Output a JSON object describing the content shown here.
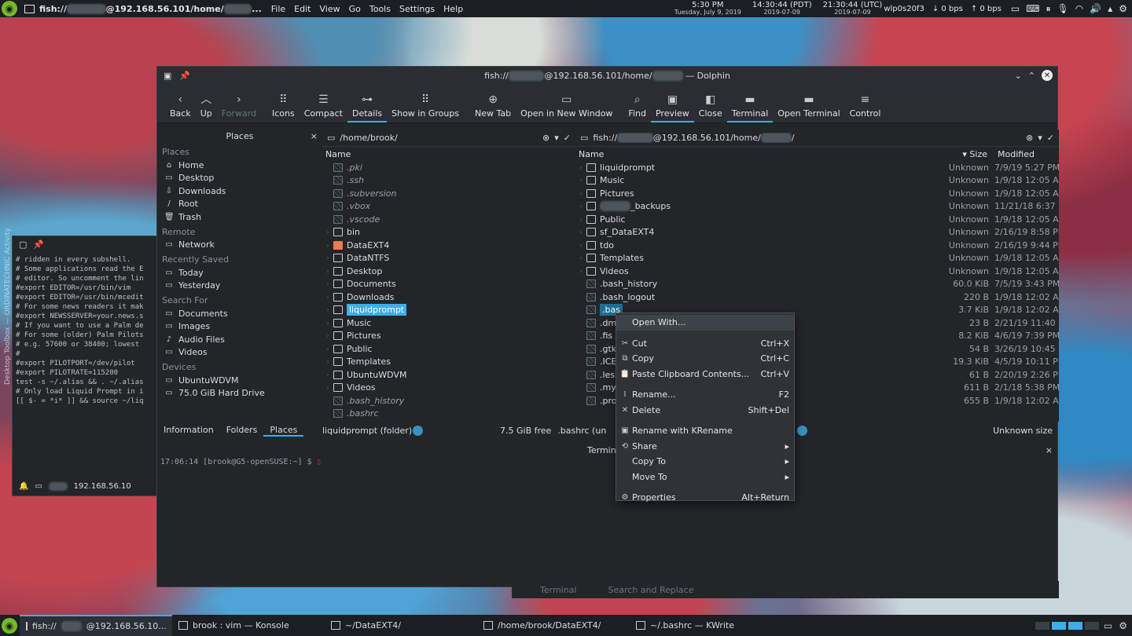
{
  "top_panel": {
    "window_title_prefix": "fish://",
    "window_title_suffix": "@192.168.56.101/home/",
    "window_title_end": "...",
    "menu": [
      "File",
      "Edit",
      "View",
      "Go",
      "Tools",
      "Settings",
      "Help"
    ],
    "clocks": [
      {
        "time": "5:30 PM",
        "date": "Tuesday, July 9, 2019"
      },
      {
        "time": "14:30:44 (PDT)",
        "date": "2019-07-09"
      },
      {
        "time": "21:30:44 (UTC)",
        "date": "2019-07-09"
      }
    ],
    "net_iface": "wlp0s20f3",
    "down_speed": "↓ 0 bps",
    "up_speed": "↑ 0 bps"
  },
  "vertical_label": "Desktop Toolbox — ORDINATECHNIC Activity",
  "vim": {
    "lines": [
      "# ridden in every subshell.",
      "",
      "# Some applications read the E",
      "# editor. So uncomment the lin",
      "#export EDITOR=/usr/bin/vim",
      "#export EDITOR=/usr/bin/mcedit",
      "",
      "# For some news readers it mak",
      "#export NEWSSERVER=your.news.s",
      "",
      "# If you want to use a Palm de",
      "# For some (older) Palm Pilots",
      "# e.g. 57600 or 38400; lowest",
      "#",
      "#export PILOTPORT=/dev/pilot",
      "#export PILOTRATE=115200",
      "",
      "test -s ~/.alias && . ~/.alias",
      "",
      "# Only load Liquid Prompt in i",
      "[[ $- = *i* ]] && source ~/liq"
    ],
    "bottom_label": "192.168.56.10"
  },
  "dolphin": {
    "title_prefix": "fish://",
    "title_mid": "@192.168.56.101/home/",
    "title_suffix": " — Dolphin",
    "toolbar": [
      {
        "label": "Back",
        "icon": "‹",
        "name": "back",
        "disabled": false
      },
      {
        "label": "Up",
        "icon": "︿",
        "name": "up",
        "disabled": false
      },
      {
        "label": "Forward",
        "icon": "›",
        "name": "forward",
        "disabled": true
      },
      {
        "label": "Icons",
        "icon": "⠿",
        "name": "icons",
        "disabled": false
      },
      {
        "label": "Compact",
        "icon": "☰",
        "name": "compact",
        "disabled": false
      },
      {
        "label": "Details",
        "icon": "⊶",
        "name": "details",
        "disabled": false,
        "active": true
      },
      {
        "label": "Show in Groups",
        "icon": "⠿",
        "name": "show-in-groups",
        "disabled": false
      },
      {
        "label": "New Tab",
        "icon": "⊕",
        "name": "new-tab",
        "disabled": false
      },
      {
        "label": "Open in New Window",
        "icon": "▭",
        "name": "open-new-window",
        "disabled": false
      },
      {
        "label": "Find",
        "icon": "⌕",
        "name": "find",
        "disabled": false
      },
      {
        "label": "Preview",
        "icon": "▣",
        "name": "preview",
        "disabled": false,
        "active": true
      },
      {
        "label": "Close",
        "icon": "◧",
        "name": "close",
        "disabled": false
      },
      {
        "label": "Terminal",
        "icon": "▬",
        "name": "terminal",
        "disabled": false,
        "active": true
      },
      {
        "label": "Open Terminal",
        "icon": "▬",
        "name": "open-terminal",
        "disabled": false
      },
      {
        "label": "Control",
        "icon": "≡",
        "name": "control",
        "disabled": false
      }
    ],
    "places": {
      "title": "Places",
      "sections": [
        {
          "header": "Places",
          "items": [
            {
              "label": "Home",
              "icon": "⌂"
            },
            {
              "label": "Desktop",
              "icon": "▭"
            },
            {
              "label": "Downloads",
              "icon": "⇩"
            },
            {
              "label": "Root",
              "icon": "/"
            },
            {
              "label": "Trash",
              "icon": "🗑"
            }
          ]
        },
        {
          "header": "Remote",
          "items": [
            {
              "label": "Network",
              "icon": "▭"
            }
          ]
        },
        {
          "header": "Recently Saved",
          "items": [
            {
              "label": "Today",
              "icon": "▭"
            },
            {
              "label": "Yesterday",
              "icon": "▭"
            }
          ]
        },
        {
          "header": "Search For",
          "items": [
            {
              "label": "Documents",
              "icon": "▭"
            },
            {
              "label": "Images",
              "icon": "▭"
            },
            {
              "label": "Audio Files",
              "icon": "♪"
            },
            {
              "label": "Videos",
              "icon": "▭"
            }
          ]
        },
        {
          "header": "Devices",
          "items": [
            {
              "label": "UbuntuWDVM",
              "icon": "▭"
            },
            {
              "label": "75.0 GiB Hard Drive",
              "icon": "▭"
            }
          ]
        }
      ]
    },
    "left_pane": {
      "path": "/home/brook/",
      "col_name": "Name",
      "rows": [
        {
          "name": ".pki",
          "hidden": true
        },
        {
          "name": ".ssh",
          "hidden": true
        },
        {
          "name": ".subversion",
          "hidden": true
        },
        {
          "name": ".vbox",
          "hidden": true
        },
        {
          "name": ".vscode",
          "hidden": true
        },
        {
          "name": "bin",
          "hidden": false
        },
        {
          "name": "DataEXT4",
          "hidden": false,
          "orange": true
        },
        {
          "name": "DataNTFS",
          "hidden": false
        },
        {
          "name": "Desktop",
          "hidden": false
        },
        {
          "name": "Documents",
          "hidden": false
        },
        {
          "name": "Downloads",
          "hidden": false
        },
        {
          "name": "liquidprompt",
          "hidden": false,
          "selected": true
        },
        {
          "name": "Music",
          "hidden": false
        },
        {
          "name": "Pictures",
          "hidden": false
        },
        {
          "name": "Public",
          "hidden": false
        },
        {
          "name": "Templates",
          "hidden": false
        },
        {
          "name": "UbuntuWDVM",
          "hidden": false
        },
        {
          "name": "Videos",
          "hidden": false
        },
        {
          "name": ".bash_history",
          "hidden": true
        },
        {
          "name": ".bashrc",
          "hidden": true
        }
      ]
    },
    "right_pane": {
      "path_prefix": "fish://",
      "path_mid": "@192.168.56.101/home/",
      "path_end": "/",
      "col_name": "Name",
      "col_size": "Size",
      "col_modified": "Modified",
      "rows": [
        {
          "name": "liquidprompt",
          "size": "Unknown",
          "mod": "7/9/19 5:27 PM"
        },
        {
          "name": "Music",
          "size": "Unknown",
          "mod": "1/9/18 12:05 AM"
        },
        {
          "name": "Pictures",
          "size": "Unknown",
          "mod": "1/9/18 12:05 AM"
        },
        {
          "name": "_backups",
          "size": "Unknown",
          "mod": "11/21/18 6:37 ..."
        },
        {
          "name": "Public",
          "size": "Unknown",
          "mod": "1/9/18 12:05 AM"
        },
        {
          "name": "sf_DataEXT4",
          "size": "Unknown",
          "mod": "2/16/19 8:58 PM"
        },
        {
          "name": "tdo",
          "size": "Unknown",
          "mod": "2/16/19 9:44 PM"
        },
        {
          "name": "Templates",
          "size": "Unknown",
          "mod": "1/9/18 12:05 AM"
        },
        {
          "name": "Videos",
          "size": "Unknown",
          "mod": "1/9/18 12:05 AM"
        },
        {
          "name": ".bash_history",
          "size": "60.0 KiB",
          "mod": "7/5/19 3:43 PM",
          "hidden": true
        },
        {
          "name": ".bash_logout",
          "size": "220 B",
          "mod": "1/9/18 12:02 AM",
          "hidden": true
        },
        {
          "name": ".bas",
          "size": "3.7 KiB",
          "mod": "1/9/18 12:02 AM",
          "hidden": true,
          "selected": true
        },
        {
          "name": ".dm",
          "size": "23 B",
          "mod": "2/21/19 11:40 ...",
          "hidden": true
        },
        {
          "name": ".fis",
          "size": "8.2 KiB",
          "mod": "4/6/19 7:39 PM",
          "hidden": true
        },
        {
          "name": ".gtk",
          "size": "54 B",
          "mod": "3/26/19 10:45 ...",
          "hidden": true
        },
        {
          "name": ".ICE",
          "size": "19.3 KiB",
          "mod": "4/5/19 10:11 PM",
          "hidden": true
        },
        {
          "name": ".les",
          "size": "61 B",
          "mod": "2/20/19 2:26 PM",
          "hidden": true
        },
        {
          "name": ".my",
          "size": "611 B",
          "mod": "2/1/18 5:38 PM",
          "hidden": true
        },
        {
          "name": ".pro",
          "size": "655 B",
          "mod": "1/9/18 12:02 AM",
          "hidden": true
        }
      ]
    },
    "status": {
      "tabs": [
        "Information",
        "Folders",
        "Places"
      ],
      "left_item": "liquidprompt (folder)",
      "left_free": "7.5 GiB free",
      "right_item": ".bashrc (un",
      "right_size": "Unknown size"
    },
    "terminal_title": "Terminal",
    "terminal_prompt": "17:06:14 [brook@G5-openSUSE:~] $"
  },
  "context_menu": [
    {
      "label": "Open With...",
      "shortcut": "",
      "icon": "",
      "highlighted": true
    },
    {
      "sep": true
    },
    {
      "label": "Cut",
      "shortcut": "Ctrl+X",
      "icon": "✂"
    },
    {
      "label": "Copy",
      "shortcut": "Ctrl+C",
      "icon": "⧉"
    },
    {
      "label": "Paste Clipboard Contents...",
      "shortcut": "Ctrl+V",
      "icon": "📋"
    },
    {
      "sep": true
    },
    {
      "label": "Rename...",
      "shortcut": "F2",
      "icon": "I"
    },
    {
      "label": "Delete",
      "shortcut": "Shift+Del",
      "icon": "✕"
    },
    {
      "sep": true
    },
    {
      "label": "Rename with KRename",
      "shortcut": "",
      "icon": "▣"
    },
    {
      "label": "Share",
      "shortcut": "",
      "icon": "⟲",
      "submenu": true
    },
    {
      "label": "Copy To",
      "shortcut": "",
      "icon": "",
      "submenu": true
    },
    {
      "label": "Move To",
      "shortcut": "",
      "icon": "",
      "submenu": true
    },
    {
      "sep": true
    },
    {
      "label": "Properties",
      "shortcut": "Alt+Return",
      "icon": "⚙"
    }
  ],
  "behind_bar": [
    "Terminal",
    "Search and Replace"
  ],
  "taskbar": [
    {
      "label": "fish://",
      "label2": "@192.168.56.10...",
      "active": true
    },
    {
      "label": "brook : vim — Konsole",
      "label2": "",
      "active": false
    },
    {
      "label": "~/DataEXT4/",
      "label2": "",
      "active": false
    },
    {
      "label": "/home/brook/DataEXT4/",
      "label2": "",
      "active": false
    },
    {
      "label": "~/.bashrc  — KWrite",
      "label2": "",
      "active": false
    }
  ],
  "accent": "#3daee9"
}
